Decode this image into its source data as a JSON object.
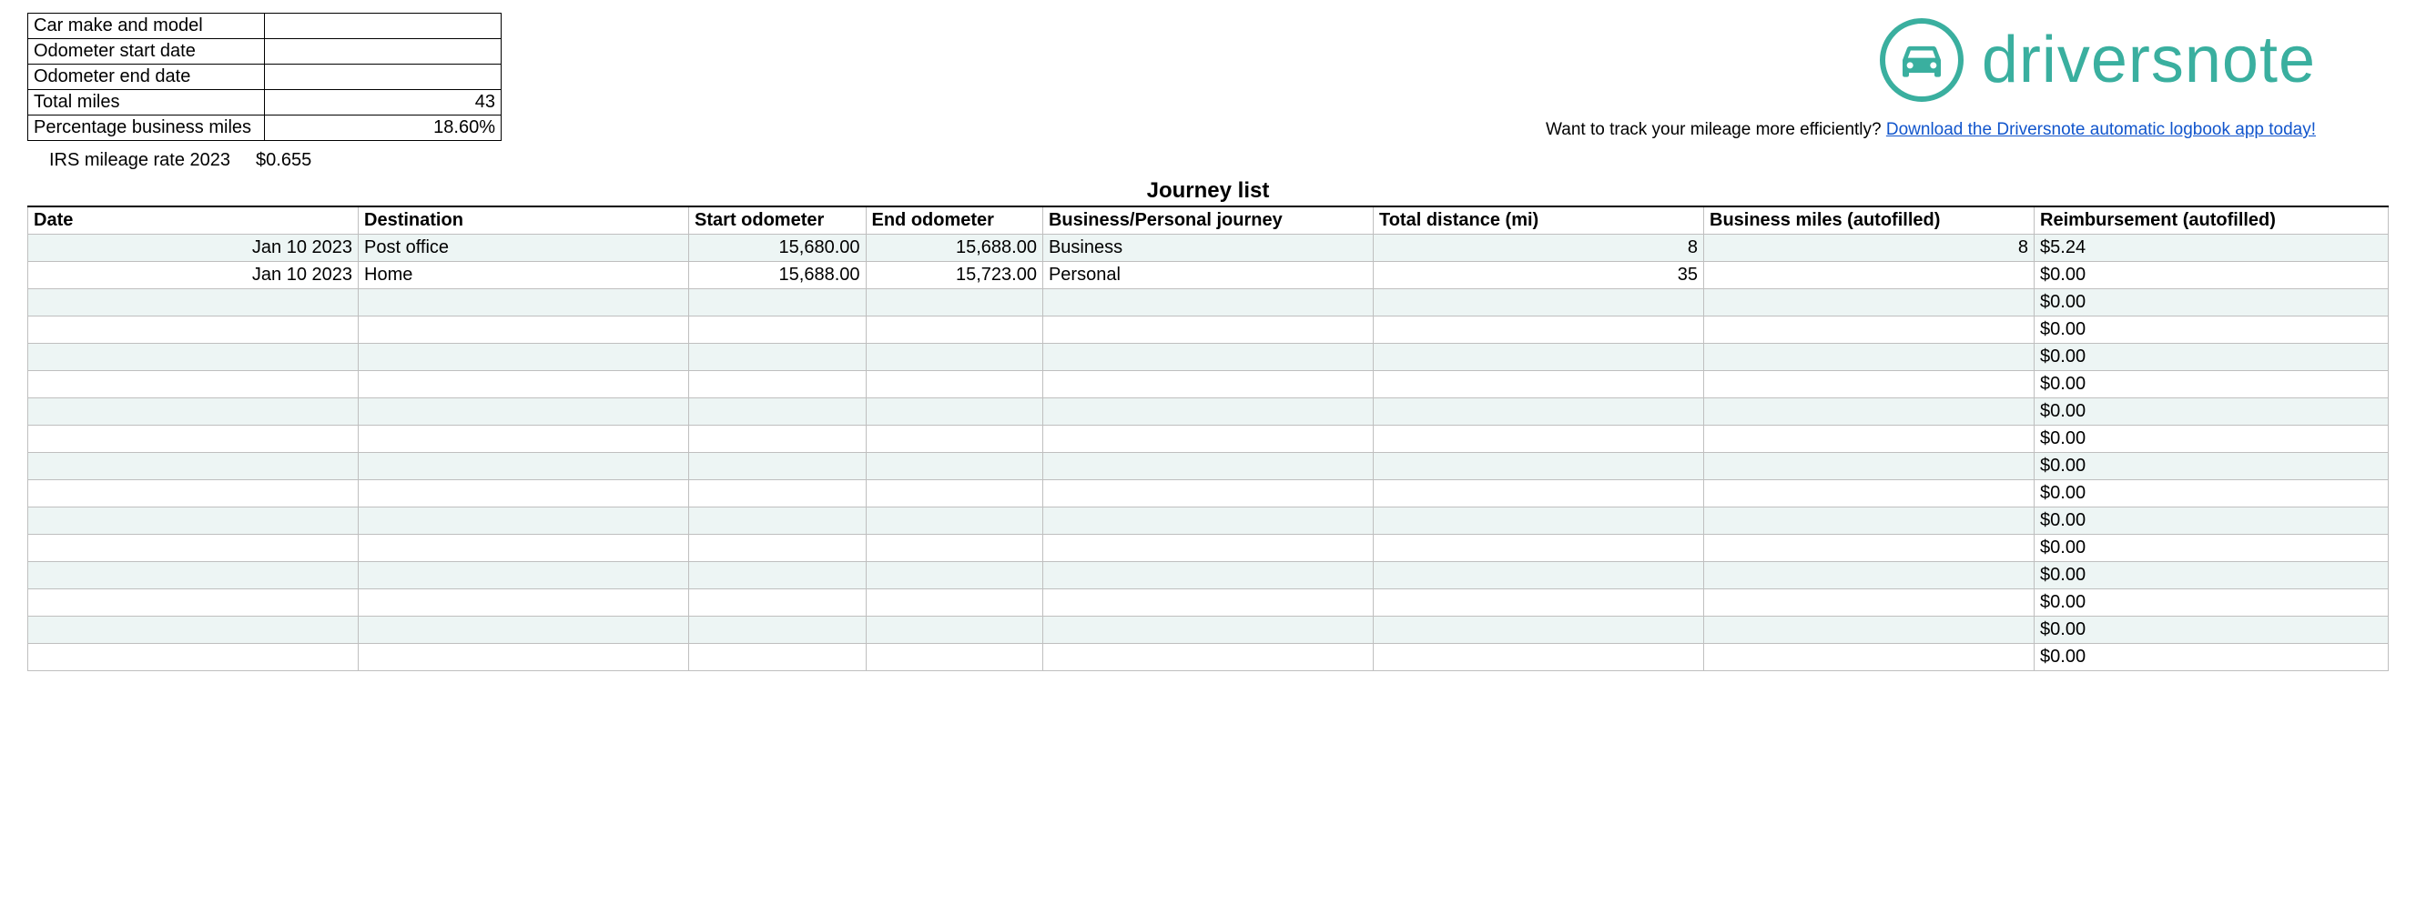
{
  "summary": {
    "rows": [
      {
        "label": "Car make and model",
        "value": ""
      },
      {
        "label": "Odometer start date",
        "value": ""
      },
      {
        "label": "Odometer end date",
        "value": ""
      },
      {
        "label": "Total miles",
        "value": "43"
      },
      {
        "label": "Percentage business miles",
        "value": "18.60%"
      }
    ]
  },
  "rate": {
    "label": "IRS mileage rate 2023",
    "value": "$0.655"
  },
  "brand": {
    "name": "driversnote",
    "color": "#3aaf9f"
  },
  "promo": {
    "text": "Want to track your mileage more efficiently? ",
    "link_text": "Download the Driversnote automatic logbook app today!"
  },
  "list": {
    "title": "Journey list",
    "headers": {
      "date": "Date",
      "destination": "Destination",
      "start_odo": "Start odometer",
      "end_odo": "End odometer",
      "bp": "Business/Personal journey",
      "distance": "Total distance (mi)",
      "biz_miles": "Business miles (autofilled)",
      "reimbursement": "Reimbursement (autofilled)"
    },
    "rows": [
      {
        "date": "Jan 10 2023",
        "destination": "Post office",
        "start_odo": "15,680.00",
        "end_odo": "15,688.00",
        "bp": "Business",
        "distance": "8",
        "biz_miles": "8",
        "reimbursement": "$5.24"
      },
      {
        "date": "Jan 10 2023",
        "destination": "Home",
        "start_odo": "15,688.00",
        "end_odo": "15,723.00",
        "bp": "Personal",
        "distance": "35",
        "biz_miles": "",
        "reimbursement": "$0.00"
      },
      {
        "date": "",
        "destination": "",
        "start_odo": "",
        "end_odo": "",
        "bp": "",
        "distance": "",
        "biz_miles": "",
        "reimbursement": "$0.00"
      },
      {
        "date": "",
        "destination": "",
        "start_odo": "",
        "end_odo": "",
        "bp": "",
        "distance": "",
        "biz_miles": "",
        "reimbursement": "$0.00"
      },
      {
        "date": "",
        "destination": "",
        "start_odo": "",
        "end_odo": "",
        "bp": "",
        "distance": "",
        "biz_miles": "",
        "reimbursement": "$0.00"
      },
      {
        "date": "",
        "destination": "",
        "start_odo": "",
        "end_odo": "",
        "bp": "",
        "distance": "",
        "biz_miles": "",
        "reimbursement": "$0.00"
      },
      {
        "date": "",
        "destination": "",
        "start_odo": "",
        "end_odo": "",
        "bp": "",
        "distance": "",
        "biz_miles": "",
        "reimbursement": "$0.00"
      },
      {
        "date": "",
        "destination": "",
        "start_odo": "",
        "end_odo": "",
        "bp": "",
        "distance": "",
        "biz_miles": "",
        "reimbursement": "$0.00"
      },
      {
        "date": "",
        "destination": "",
        "start_odo": "",
        "end_odo": "",
        "bp": "",
        "distance": "",
        "biz_miles": "",
        "reimbursement": "$0.00"
      },
      {
        "date": "",
        "destination": "",
        "start_odo": "",
        "end_odo": "",
        "bp": "",
        "distance": "",
        "biz_miles": "",
        "reimbursement": "$0.00"
      },
      {
        "date": "",
        "destination": "",
        "start_odo": "",
        "end_odo": "",
        "bp": "",
        "distance": "",
        "biz_miles": "",
        "reimbursement": "$0.00"
      },
      {
        "date": "",
        "destination": "",
        "start_odo": "",
        "end_odo": "",
        "bp": "",
        "distance": "",
        "biz_miles": "",
        "reimbursement": "$0.00"
      },
      {
        "date": "",
        "destination": "",
        "start_odo": "",
        "end_odo": "",
        "bp": "",
        "distance": "",
        "biz_miles": "",
        "reimbursement": "$0.00"
      },
      {
        "date": "",
        "destination": "",
        "start_odo": "",
        "end_odo": "",
        "bp": "",
        "distance": "",
        "biz_miles": "",
        "reimbursement": "$0.00"
      },
      {
        "date": "",
        "destination": "",
        "start_odo": "",
        "end_odo": "",
        "bp": "",
        "distance": "",
        "biz_miles": "",
        "reimbursement": "$0.00"
      },
      {
        "date": "",
        "destination": "",
        "start_odo": "",
        "end_odo": "",
        "bp": "",
        "distance": "",
        "biz_miles": "",
        "reimbursement": "$0.00"
      }
    ]
  }
}
